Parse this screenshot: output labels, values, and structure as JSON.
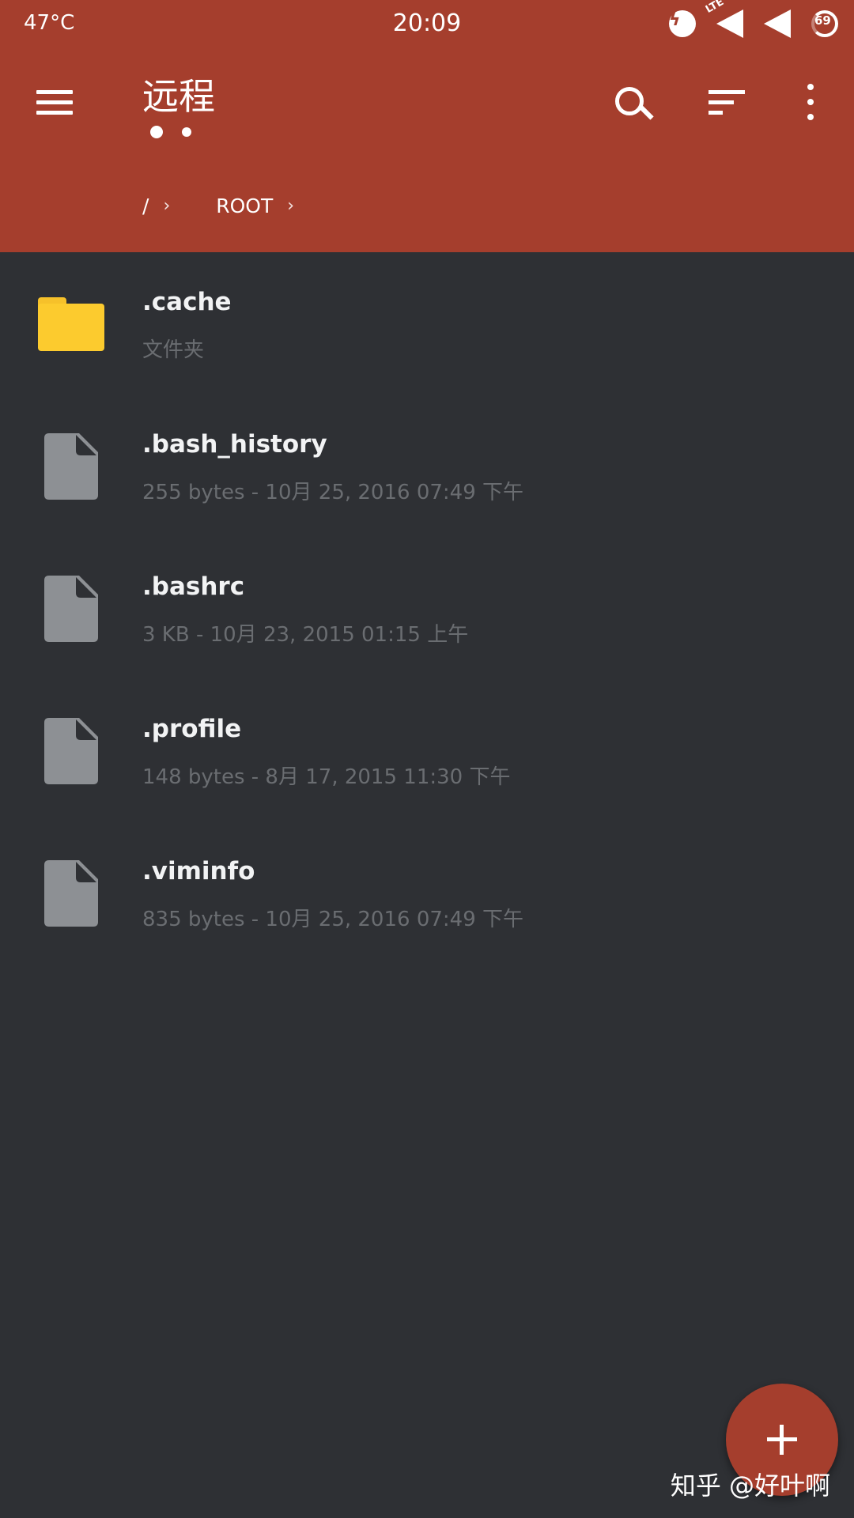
{
  "status_bar": {
    "temperature": "47°C",
    "time": "20:09",
    "network_label": "LTE",
    "battery_level": "69",
    "icons": [
      "flash-circle-icon",
      "lte-signal-icon",
      "wifi-signal-icon",
      "battery-ring-icon"
    ]
  },
  "app_bar": {
    "title": "远程",
    "page_indicator_count": 2,
    "actions": [
      "menu-icon",
      "search-icon",
      "sort-icon",
      "more-vert-icon"
    ]
  },
  "breadcrumb": [
    {
      "label": "/"
    },
    {
      "label": "ROOT"
    }
  ],
  "breadcrumb_separator": "›",
  "files": [
    {
      "name": ".cache",
      "meta": "文件夹",
      "type": "folder"
    },
    {
      "name": ".bash_history",
      "meta": "255 bytes  -  10月 25, 2016  07:49 下午",
      "type": "file"
    },
    {
      "name": ".bashrc",
      "meta": "3 KB  -  10月 23, 2015  01:15 上午",
      "type": "file"
    },
    {
      "name": ".profile",
      "meta": "148 bytes  -  8月 17, 2015  11:30 下午",
      "type": "file"
    },
    {
      "name": ".viminfo",
      "meta": "835 bytes  -  10月 25, 2016  07:49 下午",
      "type": "file"
    }
  ],
  "fab": {
    "icon": "plus-icon"
  },
  "watermark": "知乎 @好叶啊",
  "colors": {
    "app_bar": "#a53e2d",
    "background": "#2e3034",
    "folder": "#fccb2e",
    "file_icon": "#8d9094",
    "meta_text": "#6a6d71"
  }
}
